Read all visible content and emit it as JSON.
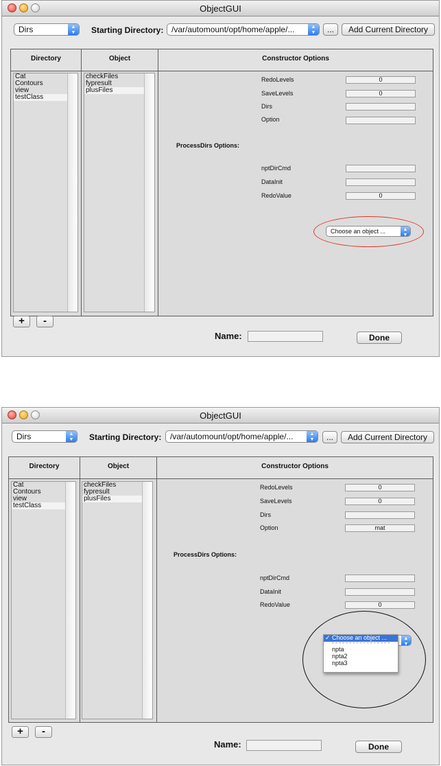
{
  "window_title": "ObjectGUI",
  "dir_mode_select": "Dirs",
  "starting_directory_label": "Starting Directory:",
  "starting_directory_value": "/var/automount/opt/home/apple/...",
  "browse_button": "...",
  "add_current_directory_button": "Add Current Directory",
  "columns": {
    "directory": "Directory",
    "object": "Object",
    "options": "Constructor Options"
  },
  "directory_list": [
    "Cat",
    "Contours",
    "view",
    "testClass"
  ],
  "selected_directory": "testClass",
  "object_list": [
    "checkFiles",
    "fypresult",
    "plusFiles"
  ],
  "selected_object": "plusFiles",
  "constructor_options": [
    {
      "label": "RedoLevels",
      "value": "0"
    },
    {
      "label": "SaveLevels",
      "value": "0"
    },
    {
      "label": "Dirs",
      "value": ""
    },
    {
      "label": "Option",
      "value": ""
    }
  ],
  "method_options_title": "ProcessDirs Options:",
  "method_options": [
    {
      "label": "nptDirCmd",
      "value": ""
    },
    {
      "label": "DataInit",
      "value": ""
    },
    {
      "label": "RedoValue",
      "value": "0"
    }
  ],
  "object_chooser": "Choose an object ...",
  "add_button": "+",
  "remove_button": "-",
  "name_label": "Name:",
  "name_value": "",
  "done_button": "Done",
  "window2": {
    "option_value": "mat",
    "menu_items": [
      "Choose an object ...",
      "npta",
      "npta2",
      "npta3"
    ],
    "menu_separator": "-----------------------"
  },
  "colors": {
    "highlight_oval_1": "#e0352b",
    "highlight_oval_2": "#111111",
    "menu_highlight": "#3875d7",
    "popup_arrow": "#2f7ee6"
  }
}
